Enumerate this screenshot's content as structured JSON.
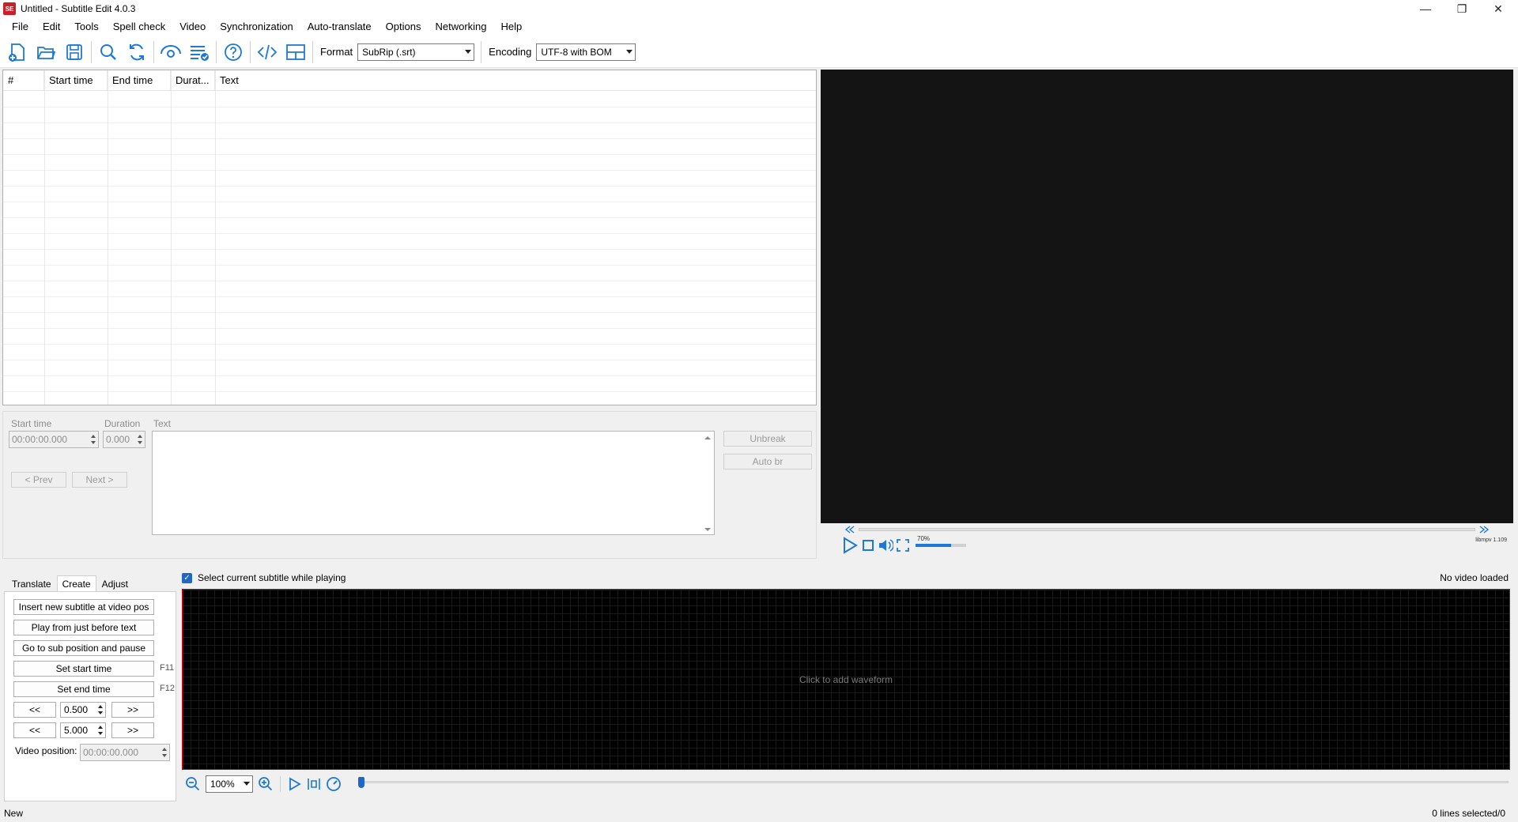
{
  "window": {
    "app_icon_text": "SE",
    "title": "Untitled - Subtitle Edit 4.0.3",
    "minimize": "—",
    "maximize": "❐",
    "close": "✕"
  },
  "menu": [
    "File",
    "Edit",
    "Tools",
    "Spell check",
    "Video",
    "Synchronization",
    "Auto-translate",
    "Options",
    "Networking",
    "Help"
  ],
  "toolbar": {
    "format_label": "Format",
    "format_value": "SubRip (.srt)",
    "encoding_label": "Encoding",
    "encoding_value": "UTF-8 with BOM"
  },
  "subtitle_list": {
    "columns": [
      "#",
      "Start time",
      "End time",
      "Durat...",
      "Text"
    ]
  },
  "edit": {
    "start_time_label": "Start time",
    "start_time_value": "00:00:00.000",
    "duration_label": "Duration",
    "duration_value": "0.000",
    "text_label": "Text",
    "prev": "< Prev",
    "next": "Next >",
    "unbreak": "Unbreak",
    "auto_br": "Auto br"
  },
  "video": {
    "volume": "70%",
    "volume_fraction": 0.7,
    "player_info": "libmpv 1.109"
  },
  "tabs": [
    "Translate",
    "Create",
    "Adjust"
  ],
  "create": {
    "insert": "Insert new subtitle at video pos",
    "play_before": "Play from just before text",
    "goto_pause": "Go to sub position and pause",
    "set_start": "Set start time",
    "set_start_key": "F11",
    "set_end": "Set end time",
    "set_end_key": "F12",
    "back": "<<",
    "fwd": ">>",
    "step1": "0.500",
    "step2": "5.000",
    "video_pos_label": "Video position:",
    "video_pos_value": "00:00:00.000"
  },
  "waveform": {
    "select_current": "Select current subtitle while playing",
    "no_video": "No video loaded",
    "hint": "Click to add waveform",
    "zoom": "100%"
  },
  "status": {
    "left": "New",
    "right": "0 lines selected/0"
  },
  "colors": {
    "accent": "#1e66c8",
    "waveform_border": "#d0001a",
    "video_bg": "#141414"
  }
}
